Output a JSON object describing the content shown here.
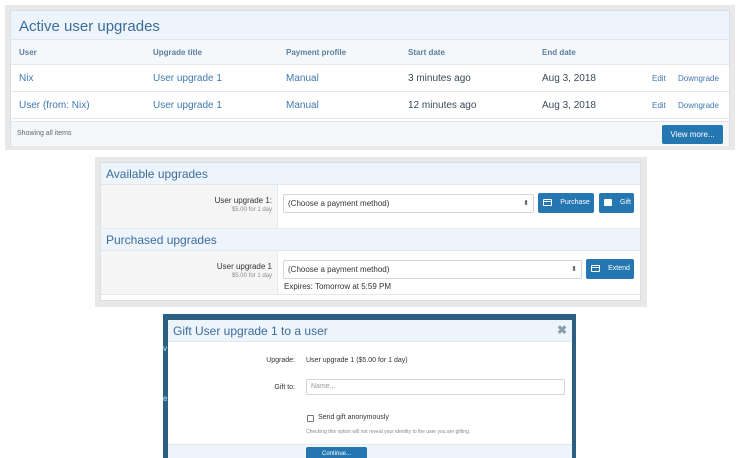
{
  "active": {
    "title": "Active user upgrades",
    "columns": [
      "User",
      "Upgrade title",
      "Payment profile",
      "Start date",
      "End date"
    ],
    "rows": [
      {
        "user": "Nix",
        "upgrade": "User upgrade 1",
        "profile": "Manual",
        "start": "3 minutes ago",
        "end": "Aug 3, 2018",
        "edit": "Edit",
        "downgrade": "Downgrade"
      },
      {
        "user": "User (from: Nix)",
        "upgrade": "User upgrade 1",
        "profile": "Manual",
        "start": "12 minutes ago",
        "end": "Aug 3, 2018",
        "edit": "Edit",
        "downgrade": "Downgrade"
      }
    ],
    "footer_text": "Showing all items",
    "view_more": "View more..."
  },
  "available": {
    "title": "Available upgrades",
    "item_name": "User upgrade 1:",
    "item_price": "$5.00 for 1 day",
    "select_value": "(Choose a payment method)",
    "purchase": "Purchase",
    "gift": "Gift"
  },
  "purchased": {
    "title": "Purchased upgrades",
    "item_name": "User upgrade 1",
    "item_price": "$5.00 for 1 day",
    "select_value": "(Choose a payment method)",
    "extend": "Extend",
    "expires": "Expires: Tomorrow at 5:59 PM"
  },
  "gift_dialog": {
    "title": "Gift User upgrade 1 to a user",
    "close": "✖",
    "upgrade_label": "Upgrade:",
    "upgrade_value": "User upgrade 1 ($5.00 for 1 day)",
    "gift_to_label": "Gift to:",
    "gift_to_placeholder": "Name...",
    "anon_label": "Send gift anonymously",
    "anon_note": "Checking this option will not reveal your identity to the user you are gifting.",
    "continue": "Continue..."
  },
  "colors": {
    "accent": "#2577b1",
    "header_bg": "#edf4fb",
    "link": "#3f79b2",
    "backdrop": "#2d5f83"
  }
}
